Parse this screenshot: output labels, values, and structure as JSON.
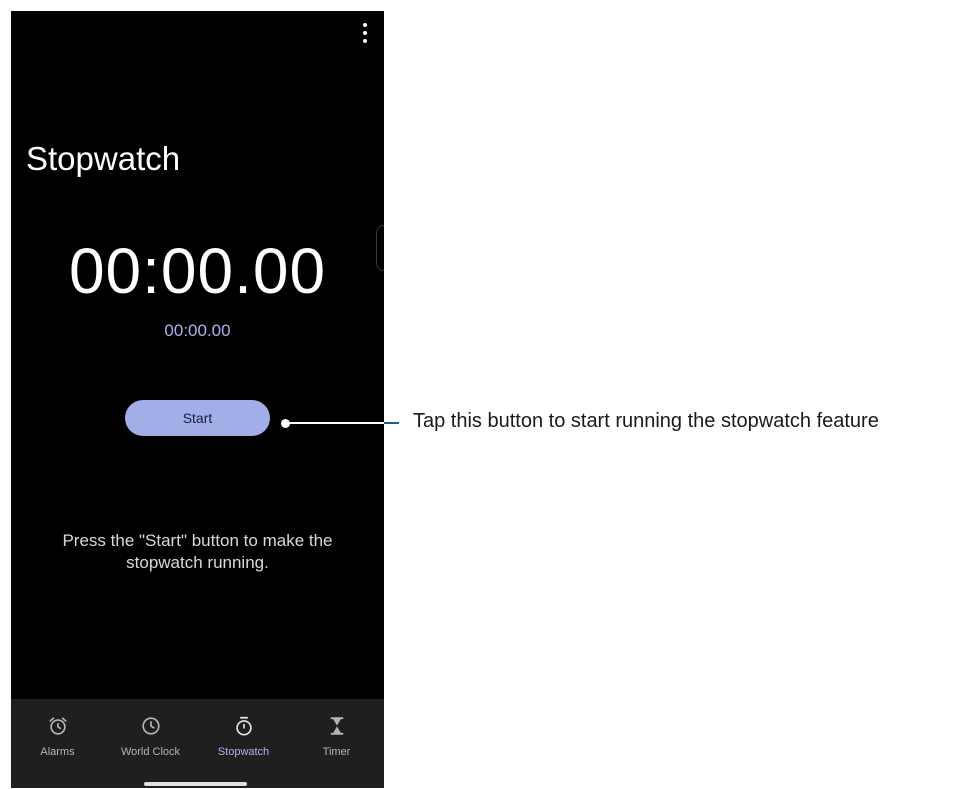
{
  "screen": {
    "title": "Stopwatch",
    "main_time": "00:00.00",
    "lap_time": "00:00.00",
    "start_label": "Start",
    "hint": "Press the \"Start\" button to make the stopwatch running."
  },
  "nav": {
    "items": [
      {
        "label": "Alarms",
        "icon": "alarm-icon",
        "active": false
      },
      {
        "label": "World Clock",
        "icon": "clock-icon",
        "active": false
      },
      {
        "label": "Stopwatch",
        "icon": "stopwatch-icon",
        "active": true
      },
      {
        "label": "Timer",
        "icon": "hourglass-icon",
        "active": false
      }
    ]
  },
  "callout": {
    "text": "Tap this button to start running the stopwatch feature"
  },
  "colors": {
    "background": "#000000",
    "accent": "#a2aee8",
    "nav_background": "#1f1f1f",
    "callout_line": "#1e5a96"
  }
}
